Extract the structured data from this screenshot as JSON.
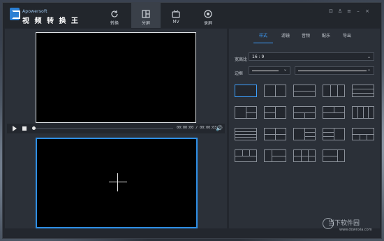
{
  "app": {
    "brand": "Apowersoft",
    "title": "视 频 转 换 王"
  },
  "nav": {
    "tabs": [
      {
        "label": "转换",
        "icon": "refresh-icon"
      },
      {
        "label": "分屏",
        "icon": "split-screen-icon"
      },
      {
        "label": "MV",
        "icon": "mv-icon"
      },
      {
        "label": "录屏",
        "icon": "record-icon"
      }
    ],
    "active": "分屏"
  },
  "window_controls": [
    "cart-icon",
    "user-icon",
    "menu-icon",
    "minimize-icon",
    "close-icon"
  ],
  "player": {
    "time": "00:00:00 / 00:00:03",
    "progress": 0.0
  },
  "right_panel": {
    "tabs": [
      "样式",
      "滤镜",
      "音频",
      "配乐",
      "导出"
    ],
    "active_tab": "样式",
    "ratio_label": "宽高比",
    "ratio_value": "16 : 9",
    "border_label": "边框"
  },
  "colors": {
    "accent": "#2e8fe6",
    "background": "#23272e",
    "panel": "#2b3038"
  },
  "watermark": {
    "text": "当下软件园",
    "url": "www.downxia.com"
  }
}
